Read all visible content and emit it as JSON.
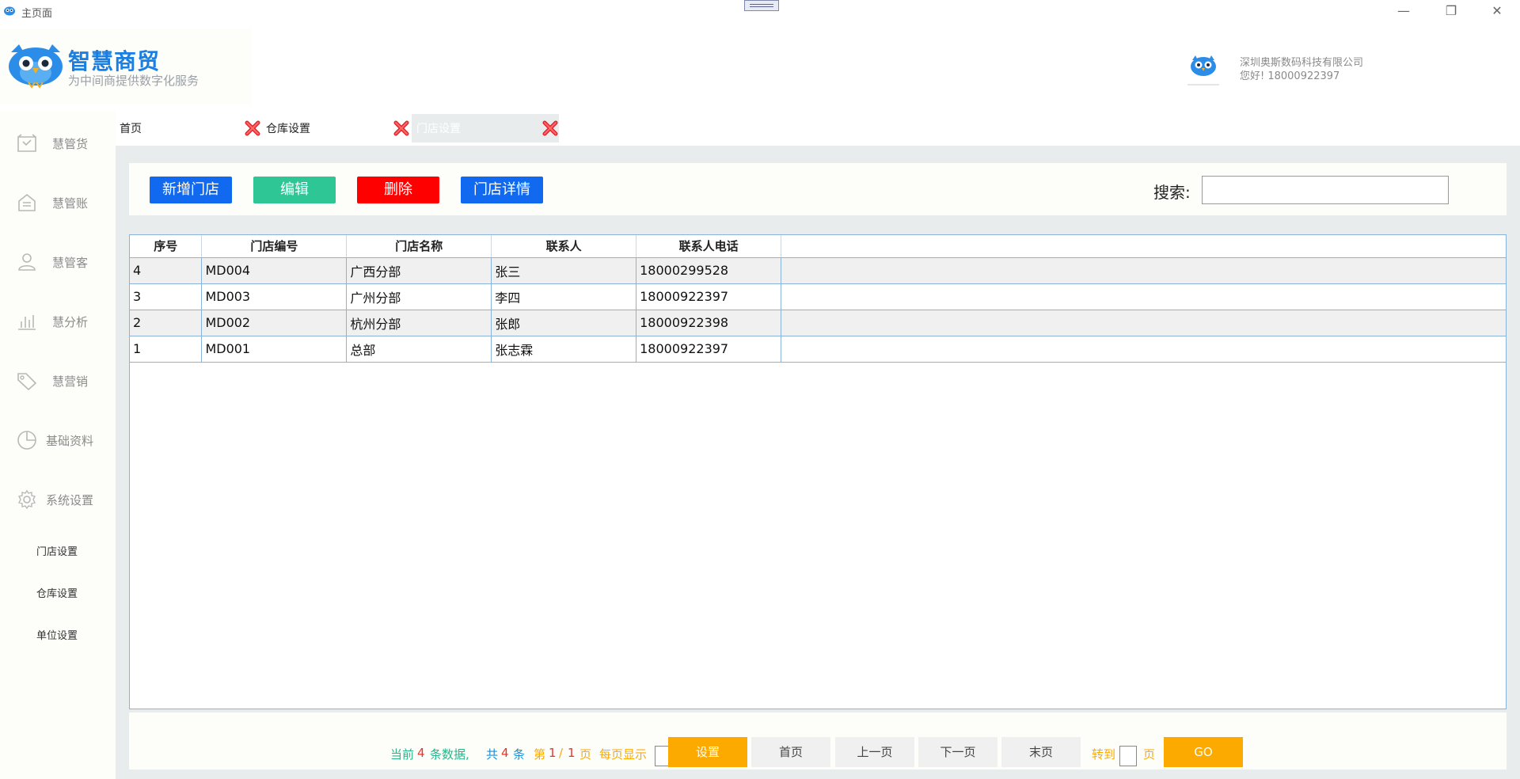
{
  "window": {
    "title": "主页面",
    "minimize": "—",
    "restore": "❐",
    "close": "✕"
  },
  "header": {
    "brand": "智慧商贸",
    "slogan": "为中间商提供数字化服务",
    "company": "深圳奥斯数码科技有限公司",
    "greeting": "您好! 18000922397"
  },
  "sidebar": {
    "items": [
      {
        "label": "慧管货",
        "icon": "goods-icon"
      },
      {
        "label": "慧管账",
        "icon": "account-icon"
      },
      {
        "label": "慧管客",
        "icon": "customer-icon"
      },
      {
        "label": "慧分析",
        "icon": "chart-icon"
      },
      {
        "label": "慧营销",
        "icon": "tag-icon"
      },
      {
        "label": "基础资料",
        "icon": "pie-icon"
      },
      {
        "label": "系统设置",
        "icon": "gear-icon"
      }
    ],
    "sub_items": [
      "门店设置",
      "仓库设置",
      "单位设置"
    ]
  },
  "tabs": [
    {
      "label": "首页"
    },
    {
      "label": "仓库设置"
    },
    {
      "label": "门店设置",
      "active": true
    }
  ],
  "toolbar": {
    "add": "新增门店",
    "edit": "编辑",
    "delete": "删除",
    "detail": "门店详情",
    "search_label": "搜索:",
    "search_value": ""
  },
  "table": {
    "columns": [
      "序号",
      "门店编号",
      "门店名称",
      "联系人",
      "联系人电话"
    ],
    "rows": [
      [
        "4",
        "MD004",
        "广西分部",
        "张三",
        "18000299528"
      ],
      [
        "3",
        "MD003",
        "广州分部",
        "李四",
        "18000922397"
      ],
      [
        "2",
        "MD002",
        "杭州分部",
        "张郎",
        "18000922398"
      ],
      [
        "1",
        "MD001",
        "总部",
        "张志霖",
        "18000922397"
      ]
    ]
  },
  "pager": {
    "current_pre": "当前",
    "current_count": "4",
    "current_post": "条数据,",
    "total_pre": "共",
    "total_count": "4",
    "total_post": "条",
    "page_pre": "第",
    "page_current": "1",
    "page_sep": "/",
    "page_total": "1",
    "page_post": "页",
    "per_page_label": "每页显示",
    "per_page_value": "",
    "set_button": "设置",
    "first": "首页",
    "prev": "上一页",
    "next": "下一页",
    "last": "末页",
    "goto_label": "转到",
    "goto_value": "",
    "goto_unit": "页",
    "go": "GO"
  },
  "colors": {
    "primary_blue": "#1169ef",
    "green": "#2ec695",
    "red": "#ff0000",
    "orange": "#fcaa00",
    "pager_green": "#2ab58a",
    "pager_red": "#e8332a",
    "pager_blue": "#1c8fd6"
  }
}
